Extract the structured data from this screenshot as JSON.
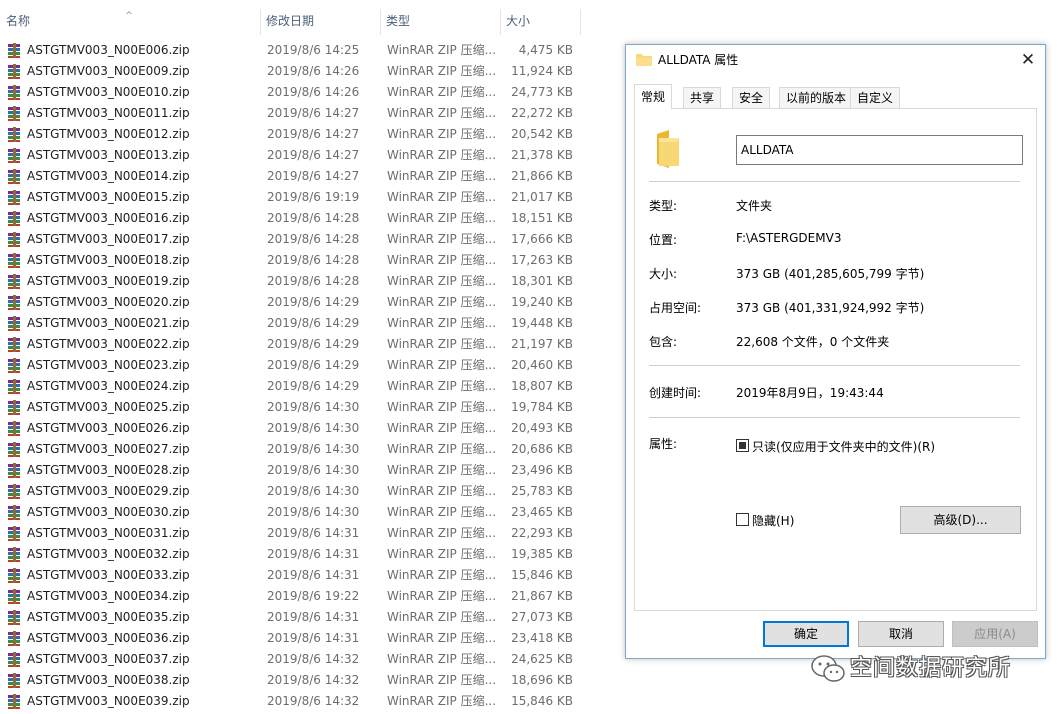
{
  "explorer": {
    "columns": {
      "name": "名称",
      "date": "修改日期",
      "type": "类型",
      "size": "大小"
    },
    "sort_icon": "sort-up-caret-icon",
    "file_icon": "winrar-archive-icon",
    "files": [
      {
        "name": "ASTGTMV003_N00E006.zip",
        "date": "2019/8/6 14:25",
        "type": "WinRAR ZIP 压缩...",
        "size": "4,475 KB"
      },
      {
        "name": "ASTGTMV003_N00E009.zip",
        "date": "2019/8/6 14:26",
        "type": "WinRAR ZIP 压缩...",
        "size": "11,924 KB"
      },
      {
        "name": "ASTGTMV003_N00E010.zip",
        "date": "2019/8/6 14:26",
        "type": "WinRAR ZIP 压缩...",
        "size": "24,773 KB"
      },
      {
        "name": "ASTGTMV003_N00E011.zip",
        "date": "2019/8/6 14:27",
        "type": "WinRAR ZIP 压缩...",
        "size": "22,272 KB"
      },
      {
        "name": "ASTGTMV003_N00E012.zip",
        "date": "2019/8/6 14:27",
        "type": "WinRAR ZIP 压缩...",
        "size": "20,542 KB"
      },
      {
        "name": "ASTGTMV003_N00E013.zip",
        "date": "2019/8/6 14:27",
        "type": "WinRAR ZIP 压缩...",
        "size": "21,378 KB"
      },
      {
        "name": "ASTGTMV003_N00E014.zip",
        "date": "2019/8/6 14:27",
        "type": "WinRAR ZIP 压缩...",
        "size": "21,866 KB"
      },
      {
        "name": "ASTGTMV003_N00E015.zip",
        "date": "2019/8/6 19:19",
        "type": "WinRAR ZIP 压缩...",
        "size": "21,017 KB"
      },
      {
        "name": "ASTGTMV003_N00E016.zip",
        "date": "2019/8/6 14:28",
        "type": "WinRAR ZIP 压缩...",
        "size": "18,151 KB"
      },
      {
        "name": "ASTGTMV003_N00E017.zip",
        "date": "2019/8/6 14:28",
        "type": "WinRAR ZIP 压缩...",
        "size": "17,666 KB"
      },
      {
        "name": "ASTGTMV003_N00E018.zip",
        "date": "2019/8/6 14:28",
        "type": "WinRAR ZIP 压缩...",
        "size": "17,263 KB"
      },
      {
        "name": "ASTGTMV003_N00E019.zip",
        "date": "2019/8/6 14:28",
        "type": "WinRAR ZIP 压缩...",
        "size": "18,301 KB"
      },
      {
        "name": "ASTGTMV003_N00E020.zip",
        "date": "2019/8/6 14:29",
        "type": "WinRAR ZIP 压缩...",
        "size": "19,240 KB"
      },
      {
        "name": "ASTGTMV003_N00E021.zip",
        "date": "2019/8/6 14:29",
        "type": "WinRAR ZIP 压缩...",
        "size": "19,448 KB"
      },
      {
        "name": "ASTGTMV003_N00E022.zip",
        "date": "2019/8/6 14:29",
        "type": "WinRAR ZIP 压缩...",
        "size": "21,197 KB"
      },
      {
        "name": "ASTGTMV003_N00E023.zip",
        "date": "2019/8/6 14:29",
        "type": "WinRAR ZIP 压缩...",
        "size": "20,460 KB"
      },
      {
        "name": "ASTGTMV003_N00E024.zip",
        "date": "2019/8/6 14:29",
        "type": "WinRAR ZIP 压缩...",
        "size": "18,807 KB"
      },
      {
        "name": "ASTGTMV003_N00E025.zip",
        "date": "2019/8/6 14:30",
        "type": "WinRAR ZIP 压缩...",
        "size": "19,784 KB"
      },
      {
        "name": "ASTGTMV003_N00E026.zip",
        "date": "2019/8/6 14:30",
        "type": "WinRAR ZIP 压缩...",
        "size": "20,493 KB"
      },
      {
        "name": "ASTGTMV003_N00E027.zip",
        "date": "2019/8/6 14:30",
        "type": "WinRAR ZIP 压缩...",
        "size": "20,686 KB"
      },
      {
        "name": "ASTGTMV003_N00E028.zip",
        "date": "2019/8/6 14:30",
        "type": "WinRAR ZIP 压缩...",
        "size": "23,496 KB"
      },
      {
        "name": "ASTGTMV003_N00E029.zip",
        "date": "2019/8/6 14:30",
        "type": "WinRAR ZIP 压缩...",
        "size": "25,783 KB"
      },
      {
        "name": "ASTGTMV003_N00E030.zip",
        "date": "2019/8/6 14:30",
        "type": "WinRAR ZIP 压缩...",
        "size": "23,465 KB"
      },
      {
        "name": "ASTGTMV003_N00E031.zip",
        "date": "2019/8/6 14:31",
        "type": "WinRAR ZIP 压缩...",
        "size": "22,293 KB"
      },
      {
        "name": "ASTGTMV003_N00E032.zip",
        "date": "2019/8/6 14:31",
        "type": "WinRAR ZIP 压缩...",
        "size": "19,385 KB"
      },
      {
        "name": "ASTGTMV003_N00E033.zip",
        "date": "2019/8/6 14:31",
        "type": "WinRAR ZIP 压缩...",
        "size": "15,846 KB"
      },
      {
        "name": "ASTGTMV003_N00E034.zip",
        "date": "2019/8/6 19:22",
        "type": "WinRAR ZIP 压缩...",
        "size": "21,867 KB"
      },
      {
        "name": "ASTGTMV003_N00E035.zip",
        "date": "2019/8/6 14:31",
        "type": "WinRAR ZIP 压缩...",
        "size": "27,073 KB"
      },
      {
        "name": "ASTGTMV003_N00E036.zip",
        "date": "2019/8/6 14:31",
        "type": "WinRAR ZIP 压缩...",
        "size": "23,418 KB"
      },
      {
        "name": "ASTGTMV003_N00E037.zip",
        "date": "2019/8/6 14:32",
        "type": "WinRAR ZIP 压缩...",
        "size": "24,625 KB"
      },
      {
        "name": "ASTGTMV003_N00E038.zip",
        "date": "2019/8/6 14:32",
        "type": "WinRAR ZIP 压缩...",
        "size": "18,696 KB"
      },
      {
        "name": "ASTGTMV003_N00E039.zip",
        "date": "2019/8/6 14:32",
        "type": "WinRAR ZIP 压缩...",
        "size": "15,846 KB"
      }
    ]
  },
  "dialog": {
    "title": "ALLDATA 属性",
    "title_icon": "folder-icon",
    "close_glyph": "✕",
    "tabs": [
      "常规",
      "共享",
      "安全",
      "以前的版本",
      "自定义"
    ],
    "active_tab": "常规",
    "folder_name": "ALLDATA",
    "properties": {
      "type_label": "类型:",
      "type_value": "文件夹",
      "location_label": "位置:",
      "location_value": "F:\\ASTERGDEMV3",
      "size_label": "大小:",
      "size_value": "373 GB (401,285,605,799 字节)",
      "size_on_disk_label": "占用空间:",
      "size_on_disk_value": "373 GB (401,331,924,992 字节)",
      "contains_label": "包含:",
      "contains_value": "22,608 个文件，0 个文件夹",
      "created_label": "创建时间:",
      "created_value": "2019年8月9日，19:43:44",
      "attributes_label": "属性:"
    },
    "attributes": {
      "readonly_label": "只读(仅应用于文件夹中的文件)(R)",
      "readonly_state": "checked",
      "hidden_label": "隐藏(H)",
      "hidden_state": "unchecked",
      "advanced_label": "高级(D)..."
    },
    "buttons": {
      "ok": "确定",
      "cancel": "取消",
      "apply": "应用(A)"
    }
  },
  "watermark": {
    "text": "空间数据研究所",
    "icon": "wechat-logo-icon"
  },
  "colors": {
    "header_text": "#4c607a",
    "secondary_text": "#6d6d6d",
    "dialog_border": "#7ea6cf",
    "primary_button_border": "#0078d7",
    "folder_yellow": "#f8d775"
  }
}
